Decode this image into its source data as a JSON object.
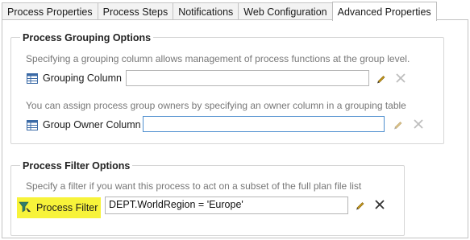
{
  "tabs": [
    {
      "label": "Process Properties"
    },
    {
      "label": "Process Steps"
    },
    {
      "label": "Notifications"
    },
    {
      "label": "Web Configuration"
    },
    {
      "label": "Advanced Properties",
      "active": true
    }
  ],
  "grouping": {
    "title": "Process Grouping Options",
    "hint1": "Specifying a grouping column allows management of process functions at the group level.",
    "grouping_column_label": "Grouping Column",
    "grouping_column_value": "",
    "hint2": "You can assign process group owners by specifying an owner column in a grouping table",
    "owner_column_label": "Group Owner Column",
    "owner_column_value": ""
  },
  "filter": {
    "title": "Process Filter Options",
    "hint": "Specify a filter if you want this process to act on a subset of the full plan file list",
    "label": "Process Filter",
    "value": "DEPT.WorldRegion = 'Europe'",
    "highlight_color": "#f7f33a"
  },
  "icons": {
    "table": "table-icon",
    "edit": "pencil-icon",
    "clear": "x-icon",
    "filter": "filter-icon"
  }
}
